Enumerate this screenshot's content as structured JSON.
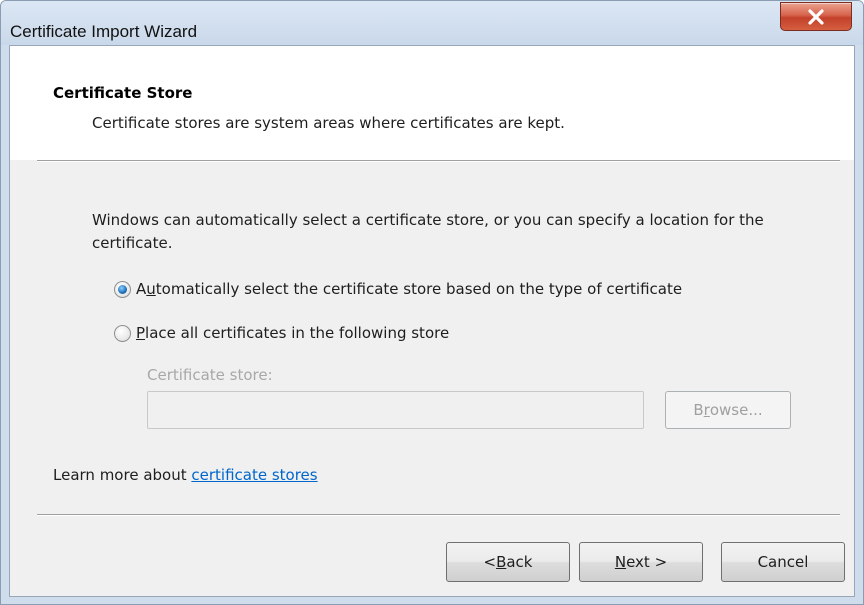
{
  "window": {
    "title": "Certificate Import Wizard",
    "close_icon": "close-icon"
  },
  "header": {
    "title": "Certificate Store",
    "subtitle": "Certificate stores are system areas where certificates are kept."
  },
  "body": {
    "intro": "Windows can automatically select a certificate store, or you can specify a location for the certificate.",
    "options": [
      {
        "label": "Automatically select the certificate store based on the type of certificate",
        "accelerator": "u",
        "selected": true
      },
      {
        "label": "Place all certificates in the following store",
        "accelerator": "P",
        "selected": false
      }
    ],
    "store_label": "Certificate store:",
    "store_value": "",
    "browse_label": "Browse..."
  },
  "footer": {
    "learn_prefix": "Learn more about ",
    "learn_link": "certificate stores",
    "back_label": "< Back",
    "next_label": "Next >",
    "cancel_label": "Cancel"
  },
  "colors": {
    "link": "#0066cc",
    "radio_selected": "#1c6fb8",
    "close_button": "#c3412a"
  }
}
